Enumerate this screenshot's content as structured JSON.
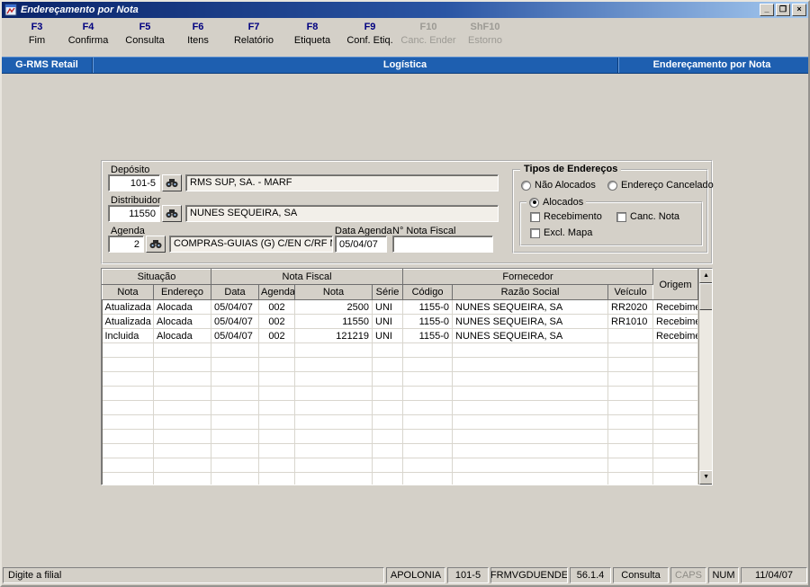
{
  "window": {
    "title": "Endereçamento por Nota",
    "controls": {
      "minimize": "_",
      "maximize": "❐",
      "close": "×"
    }
  },
  "toolbar": {
    "items": [
      {
        "key": "F3",
        "label": "Fim",
        "enabled": true
      },
      {
        "key": "F4",
        "label": "Confirma",
        "enabled": true
      },
      {
        "key": "F5",
        "label": "Consulta",
        "enabled": true
      },
      {
        "key": "F6",
        "label": "Itens",
        "enabled": true
      },
      {
        "key": "F7",
        "label": "Relatório",
        "enabled": true
      },
      {
        "key": "F8",
        "label": "Etiqueta",
        "enabled": true
      },
      {
        "key": "F9",
        "label": "Conf. Etiq.",
        "enabled": true
      },
      {
        "key": "F10",
        "label": "Canc. Ender",
        "enabled": false
      },
      {
        "key": "ShF10",
        "label": "Estorno",
        "enabled": false
      }
    ]
  },
  "banner": {
    "left": "G-RMS Retail",
    "center": "Logística",
    "right": "Endereçamento por Nota"
  },
  "form": {
    "deposito_label": "Depósito",
    "deposito_code": "101-5",
    "deposito_name": "RMS SUP, SA. - MARF",
    "distribuidor_label": "Distribuidor",
    "distribuidor_code": "11550",
    "distribuidor_name": "NUNES SEQUEIRA, SA",
    "agenda_label": "Agenda",
    "agenda_code": "2",
    "agenda_name": "COMPRAS-GUIAS (G) C/EN C/RF MN",
    "data_agenda_label": "Data Agenda",
    "data_agenda_value": "05/04/07",
    "nota_fiscal_label": "N° Nota Fiscal",
    "nota_fiscal_value": "",
    "tipos": {
      "title": "Tipos de Endereços",
      "nao_alocados": "Não Alocados",
      "endereco_cancelado": "Endereço Cancelado",
      "alocados": "Alocados",
      "recebimento": "Recebimento",
      "canc_nota": "Canc. Nota",
      "excl_mapa": "Excl. Mapa",
      "selected": "Alocados"
    }
  },
  "grid": {
    "group_situacao": "Situação",
    "group_nota_fiscal": "Nota Fiscal",
    "group_fornecedor": "Fornecedor",
    "group_origem": "Origem",
    "columns": [
      "Nota",
      "Endereço",
      "Data",
      "Agenda",
      "Nota",
      "Série",
      "Código",
      "Razão Social",
      "Veículo"
    ],
    "rows": [
      [
        "Atualizada",
        "Alocada",
        "05/04/07",
        "002",
        "2500",
        "UNI",
        "1155-0",
        "NUNES SEQUEIRA, SA",
        "RR2020",
        "Recebimento"
      ],
      [
        "Atualizada",
        "Alocada",
        "05/04/07",
        "002",
        "11550",
        "UNI",
        "1155-0",
        "NUNES SEQUEIRA, SA",
        "RR1010",
        "Recebimento"
      ],
      [
        "Incluida",
        "Alocada",
        "05/04/07",
        "002",
        "121219",
        "UNI",
        "1155-0",
        "NUNES SEQUEIRA, SA",
        "",
        "Recebimento"
      ]
    ],
    "visible_rows": 13
  },
  "statusbar": {
    "message": "Digite a filial",
    "user": "APOLONIA",
    "filial": "101-5",
    "form_id": "FRMVGDUENDE",
    "version": "56.1.4",
    "mode": "Consulta",
    "caps": "CAPS",
    "num": "NUM",
    "date": "11/04/07"
  }
}
